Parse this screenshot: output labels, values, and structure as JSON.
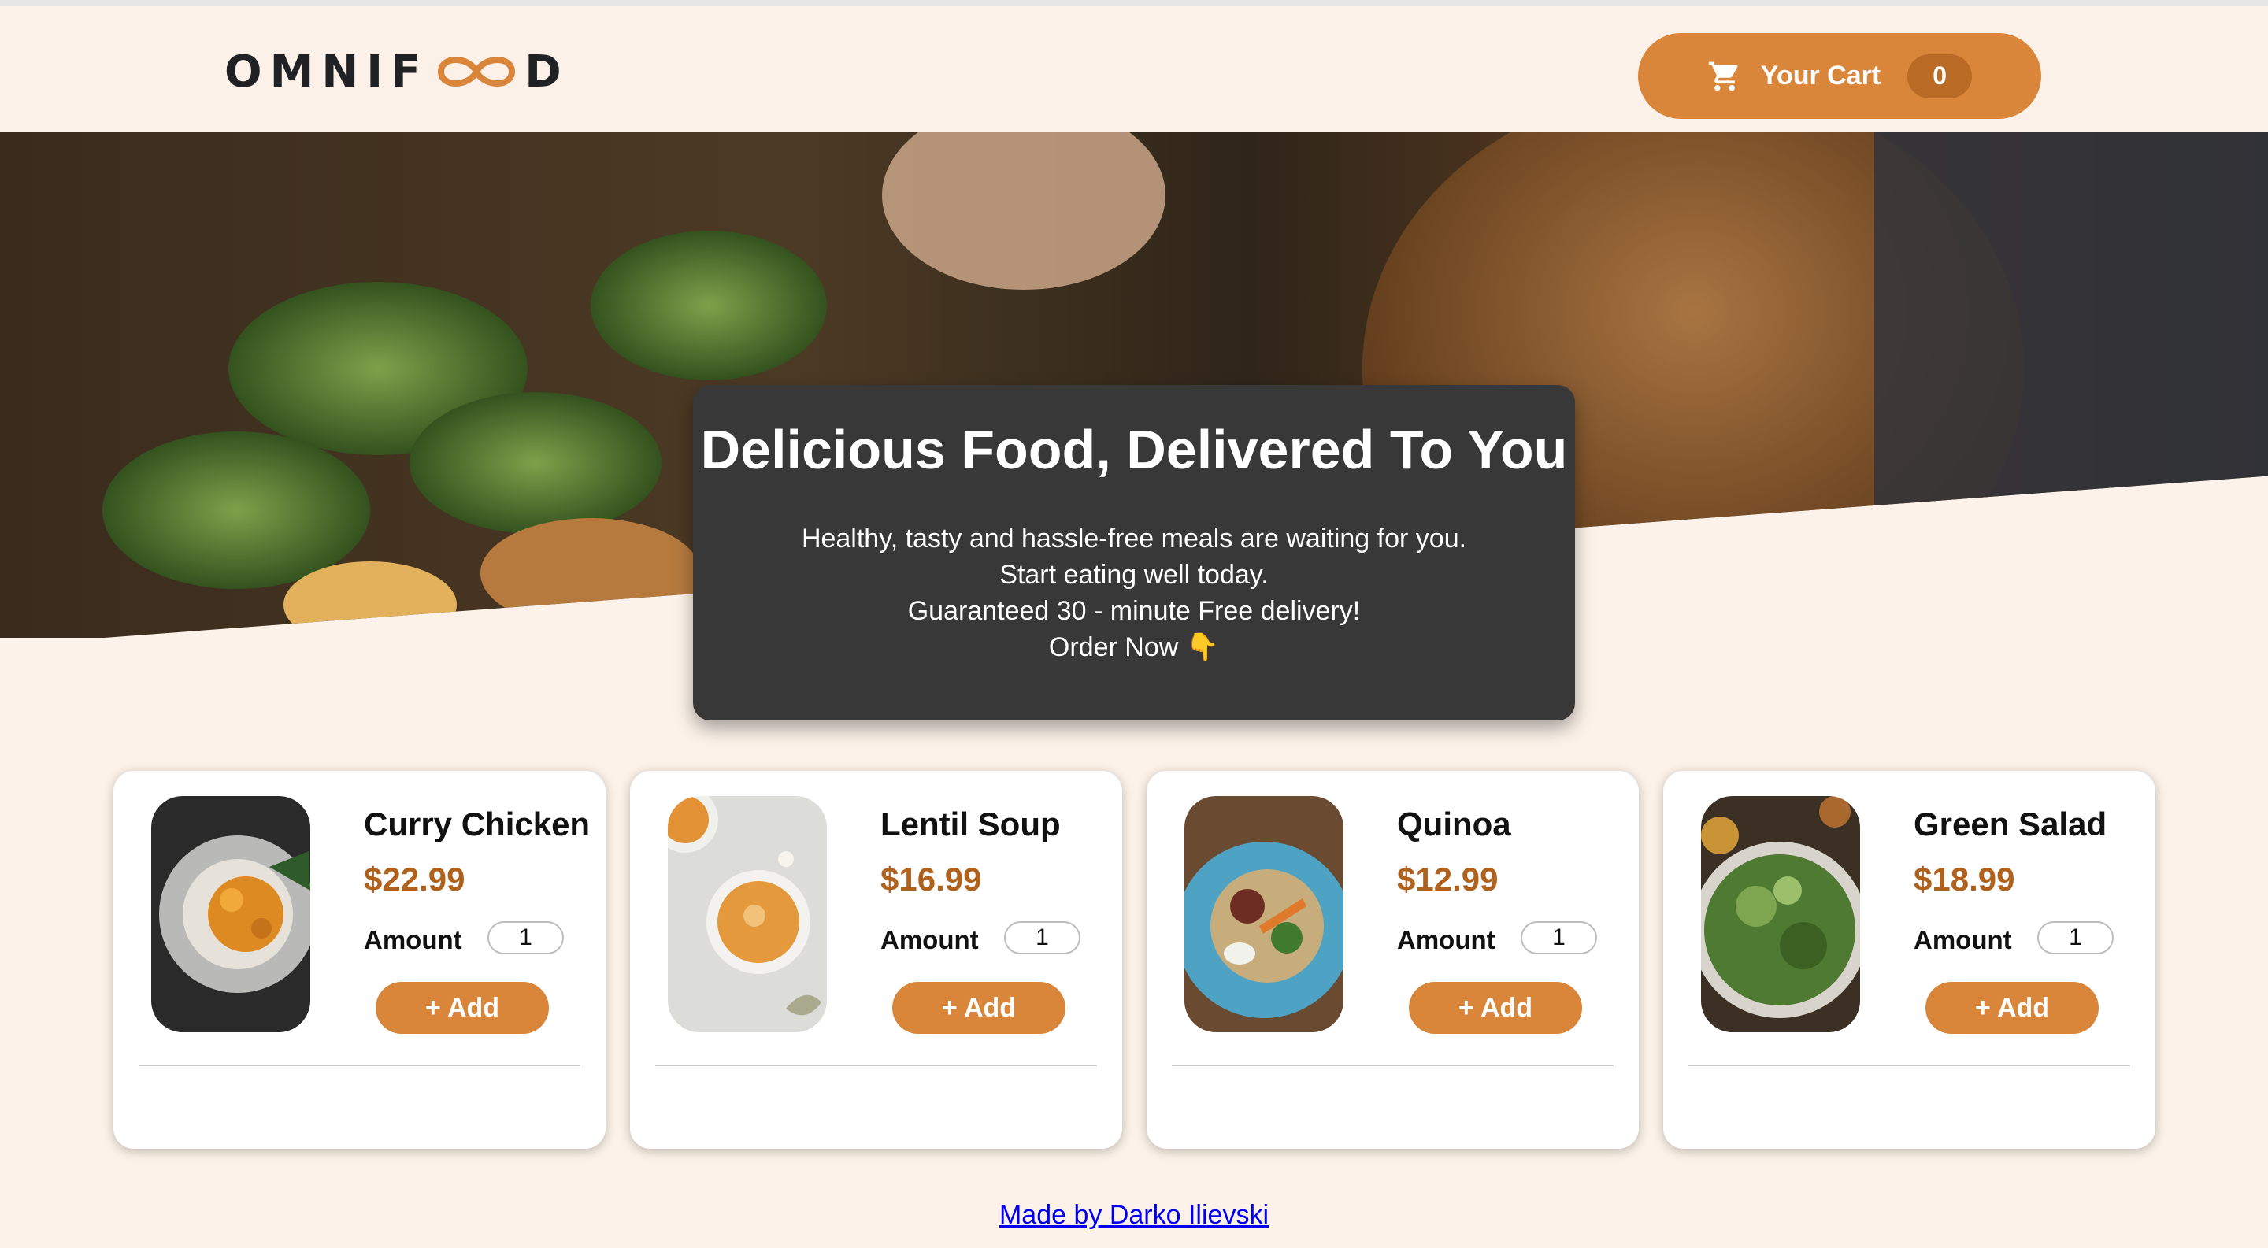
{
  "header": {
    "logo_left": "OMNIF",
    "logo_right": "D",
    "cart_label": "Your Cart",
    "cart_count": "0"
  },
  "hero": {
    "title": "Delicious Food, Delivered To You",
    "lines": [
      "Healthy, tasty and hassle-free meals are waiting for you.",
      "Start eating well today.",
      "Guaranteed 30 - minute Free delivery!",
      "Order Now 👇"
    ]
  },
  "meals": [
    {
      "name": "Curry Chicken",
      "price": "$22.99",
      "amount_label": "Amount",
      "amount": "1",
      "add_label": "+ Add"
    },
    {
      "name": "Lentil Soup",
      "price": "$16.99",
      "amount_label": "Amount",
      "amount": "1",
      "add_label": "+ Add"
    },
    {
      "name": "Quinoa",
      "price": "$12.99",
      "amount_label": "Amount",
      "amount": "1",
      "add_label": "+ Add"
    },
    {
      "name": "Green Salad",
      "price": "$18.99",
      "amount_label": "Amount",
      "amount": "1",
      "add_label": "+ Add"
    }
  ],
  "footer": {
    "link_text": "Made by Darko Ilievski"
  },
  "colors": {
    "accent": "#d9853a",
    "price": "#b0621d",
    "background": "#fcf2e9",
    "summary_bg": "#383838"
  }
}
